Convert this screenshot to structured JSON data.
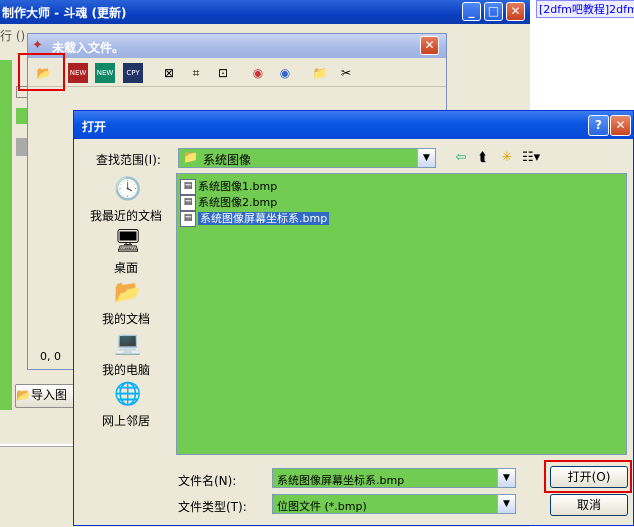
{
  "main_window": {
    "title": "制作大师 - 斗魂 (更新)",
    "menu_fragment": "行 ()",
    "coords": "0,  0",
    "import_button_label": "导入图",
    "right_panel_link": "[2dfm吧教程]2dfm"
  },
  "middle_window": {
    "title": "未载入文件。",
    "toolbar": [
      {
        "name": "open-folder-icon",
        "glyph": "📂"
      },
      {
        "name": "new-icon-1",
        "glyph": "NEW"
      },
      {
        "name": "new-icon-2",
        "glyph": "NEW"
      },
      {
        "name": "cpy-icon",
        "glyph": "CPY"
      },
      {
        "name": "zoom-fit-icon",
        "glyph": "⊠"
      },
      {
        "name": "crop-icon",
        "glyph": "⌗"
      },
      {
        "name": "frame-icon",
        "glyph": "⊡"
      },
      {
        "name": "palette-icon-1",
        "glyph": "◉"
      },
      {
        "name": "palette-icon-2",
        "glyph": "◉"
      },
      {
        "name": "export-folder-icon",
        "glyph": "📁"
      },
      {
        "name": "tools-icon",
        "glyph": "✂"
      }
    ]
  },
  "open_dialog": {
    "title": "打开",
    "look_in_label": "查找范围(I):",
    "look_in_value": "系统图像",
    "places": [
      {
        "name": "recent-documents",
        "label": "我最近的文档",
        "icon": "🕓"
      },
      {
        "name": "desktop",
        "label": "桌面",
        "icon": "🖥"
      },
      {
        "name": "my-documents",
        "label": "我的文档",
        "icon": "📂"
      },
      {
        "name": "my-computer",
        "label": "我的电脑",
        "icon": "💻"
      },
      {
        "name": "network-places",
        "label": "网上邻居",
        "icon": "🌐"
      }
    ],
    "files": [
      {
        "name": "系统图像1.bmp",
        "selected": false
      },
      {
        "name": "系统图像2.bmp",
        "selected": false
      },
      {
        "name": "系统图像屏幕坐标系.bmp",
        "selected": true
      }
    ],
    "file_name_label": "文件名(N):",
    "file_name_value": "系统图像屏幕坐标系.bmp",
    "file_type_label": "文件类型(T):",
    "file_type_value": "位图文件 (*.bmp)",
    "open_button": "打开(O)",
    "cancel_button": "取消"
  }
}
